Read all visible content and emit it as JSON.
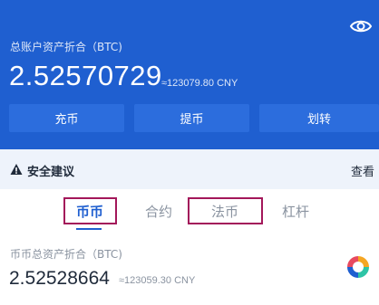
{
  "header": {
    "total_label": "总账户资产折合（BTC)",
    "total_amount": "2.52570729",
    "total_cny": "≈123079.80 CNY",
    "buttons": {
      "deposit": "充币",
      "withdraw": "提币",
      "transfer": "划转"
    }
  },
  "security": {
    "title": "安全建议",
    "view_label": "查看"
  },
  "tabs": [
    {
      "label": "币币",
      "active": true
    },
    {
      "label": "合约",
      "active": false
    },
    {
      "label": "法币",
      "active": false
    },
    {
      "label": "杠杆",
      "active": false
    }
  ],
  "account": {
    "label": "币币总资产折合（BTC)",
    "amount": "2.52528664",
    "cny": "≈123059.30 CNY"
  },
  "colors": {
    "header_bg": "#1f5fd0",
    "accent": "#1f5fd0",
    "highlight_border": "#a3175a"
  }
}
